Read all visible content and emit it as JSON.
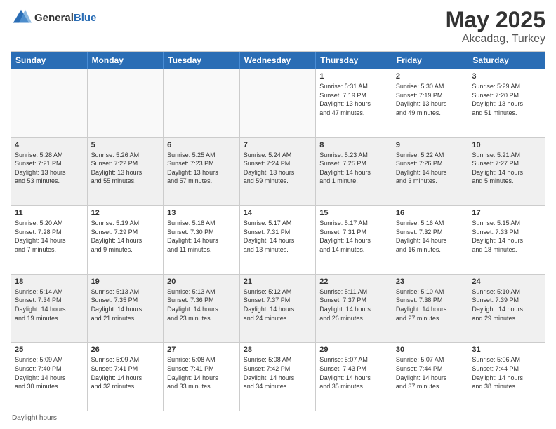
{
  "logo": {
    "general": "General",
    "blue": "Blue"
  },
  "title": "May 2025",
  "location": "Akcadag, Turkey",
  "footer": "Daylight hours",
  "weekdays": [
    "Sunday",
    "Monday",
    "Tuesday",
    "Wednesday",
    "Thursday",
    "Friday",
    "Saturday"
  ],
  "rows": [
    [
      {
        "day": "",
        "info": "",
        "empty": true
      },
      {
        "day": "",
        "info": "",
        "empty": true
      },
      {
        "day": "",
        "info": "",
        "empty": true
      },
      {
        "day": "",
        "info": "",
        "empty": true
      },
      {
        "day": "1",
        "info": "Sunrise: 5:31 AM\nSunset: 7:19 PM\nDaylight: 13 hours\nand 47 minutes."
      },
      {
        "day": "2",
        "info": "Sunrise: 5:30 AM\nSunset: 7:19 PM\nDaylight: 13 hours\nand 49 minutes."
      },
      {
        "day": "3",
        "info": "Sunrise: 5:29 AM\nSunset: 7:20 PM\nDaylight: 13 hours\nand 51 minutes."
      }
    ],
    [
      {
        "day": "4",
        "info": "Sunrise: 5:28 AM\nSunset: 7:21 PM\nDaylight: 13 hours\nand 53 minutes.",
        "shaded": true
      },
      {
        "day": "5",
        "info": "Sunrise: 5:26 AM\nSunset: 7:22 PM\nDaylight: 13 hours\nand 55 minutes.",
        "shaded": true
      },
      {
        "day": "6",
        "info": "Sunrise: 5:25 AM\nSunset: 7:23 PM\nDaylight: 13 hours\nand 57 minutes.",
        "shaded": true
      },
      {
        "day": "7",
        "info": "Sunrise: 5:24 AM\nSunset: 7:24 PM\nDaylight: 13 hours\nand 59 minutes.",
        "shaded": true
      },
      {
        "day": "8",
        "info": "Sunrise: 5:23 AM\nSunset: 7:25 PM\nDaylight: 14 hours\nand 1 minute.",
        "shaded": true
      },
      {
        "day": "9",
        "info": "Sunrise: 5:22 AM\nSunset: 7:26 PM\nDaylight: 14 hours\nand 3 minutes.",
        "shaded": true
      },
      {
        "day": "10",
        "info": "Sunrise: 5:21 AM\nSunset: 7:27 PM\nDaylight: 14 hours\nand 5 minutes.",
        "shaded": true
      }
    ],
    [
      {
        "day": "11",
        "info": "Sunrise: 5:20 AM\nSunset: 7:28 PM\nDaylight: 14 hours\nand 7 minutes."
      },
      {
        "day": "12",
        "info": "Sunrise: 5:19 AM\nSunset: 7:29 PM\nDaylight: 14 hours\nand 9 minutes."
      },
      {
        "day": "13",
        "info": "Sunrise: 5:18 AM\nSunset: 7:30 PM\nDaylight: 14 hours\nand 11 minutes."
      },
      {
        "day": "14",
        "info": "Sunrise: 5:17 AM\nSunset: 7:31 PM\nDaylight: 14 hours\nand 13 minutes."
      },
      {
        "day": "15",
        "info": "Sunrise: 5:17 AM\nSunset: 7:31 PM\nDaylight: 14 hours\nand 14 minutes."
      },
      {
        "day": "16",
        "info": "Sunrise: 5:16 AM\nSunset: 7:32 PM\nDaylight: 14 hours\nand 16 minutes."
      },
      {
        "day": "17",
        "info": "Sunrise: 5:15 AM\nSunset: 7:33 PM\nDaylight: 14 hours\nand 18 minutes."
      }
    ],
    [
      {
        "day": "18",
        "info": "Sunrise: 5:14 AM\nSunset: 7:34 PM\nDaylight: 14 hours\nand 19 minutes.",
        "shaded": true
      },
      {
        "day": "19",
        "info": "Sunrise: 5:13 AM\nSunset: 7:35 PM\nDaylight: 14 hours\nand 21 minutes.",
        "shaded": true
      },
      {
        "day": "20",
        "info": "Sunrise: 5:13 AM\nSunset: 7:36 PM\nDaylight: 14 hours\nand 23 minutes.",
        "shaded": true
      },
      {
        "day": "21",
        "info": "Sunrise: 5:12 AM\nSunset: 7:37 PM\nDaylight: 14 hours\nand 24 minutes.",
        "shaded": true
      },
      {
        "day": "22",
        "info": "Sunrise: 5:11 AM\nSunset: 7:37 PM\nDaylight: 14 hours\nand 26 minutes.",
        "shaded": true
      },
      {
        "day": "23",
        "info": "Sunrise: 5:10 AM\nSunset: 7:38 PM\nDaylight: 14 hours\nand 27 minutes.",
        "shaded": true
      },
      {
        "day": "24",
        "info": "Sunrise: 5:10 AM\nSunset: 7:39 PM\nDaylight: 14 hours\nand 29 minutes.",
        "shaded": true
      }
    ],
    [
      {
        "day": "25",
        "info": "Sunrise: 5:09 AM\nSunset: 7:40 PM\nDaylight: 14 hours\nand 30 minutes."
      },
      {
        "day": "26",
        "info": "Sunrise: 5:09 AM\nSunset: 7:41 PM\nDaylight: 14 hours\nand 32 minutes."
      },
      {
        "day": "27",
        "info": "Sunrise: 5:08 AM\nSunset: 7:41 PM\nDaylight: 14 hours\nand 33 minutes."
      },
      {
        "day": "28",
        "info": "Sunrise: 5:08 AM\nSunset: 7:42 PM\nDaylight: 14 hours\nand 34 minutes."
      },
      {
        "day": "29",
        "info": "Sunrise: 5:07 AM\nSunset: 7:43 PM\nDaylight: 14 hours\nand 35 minutes."
      },
      {
        "day": "30",
        "info": "Sunrise: 5:07 AM\nSunset: 7:44 PM\nDaylight: 14 hours\nand 37 minutes."
      },
      {
        "day": "31",
        "info": "Sunrise: 5:06 AM\nSunset: 7:44 PM\nDaylight: 14 hours\nand 38 minutes."
      }
    ]
  ]
}
